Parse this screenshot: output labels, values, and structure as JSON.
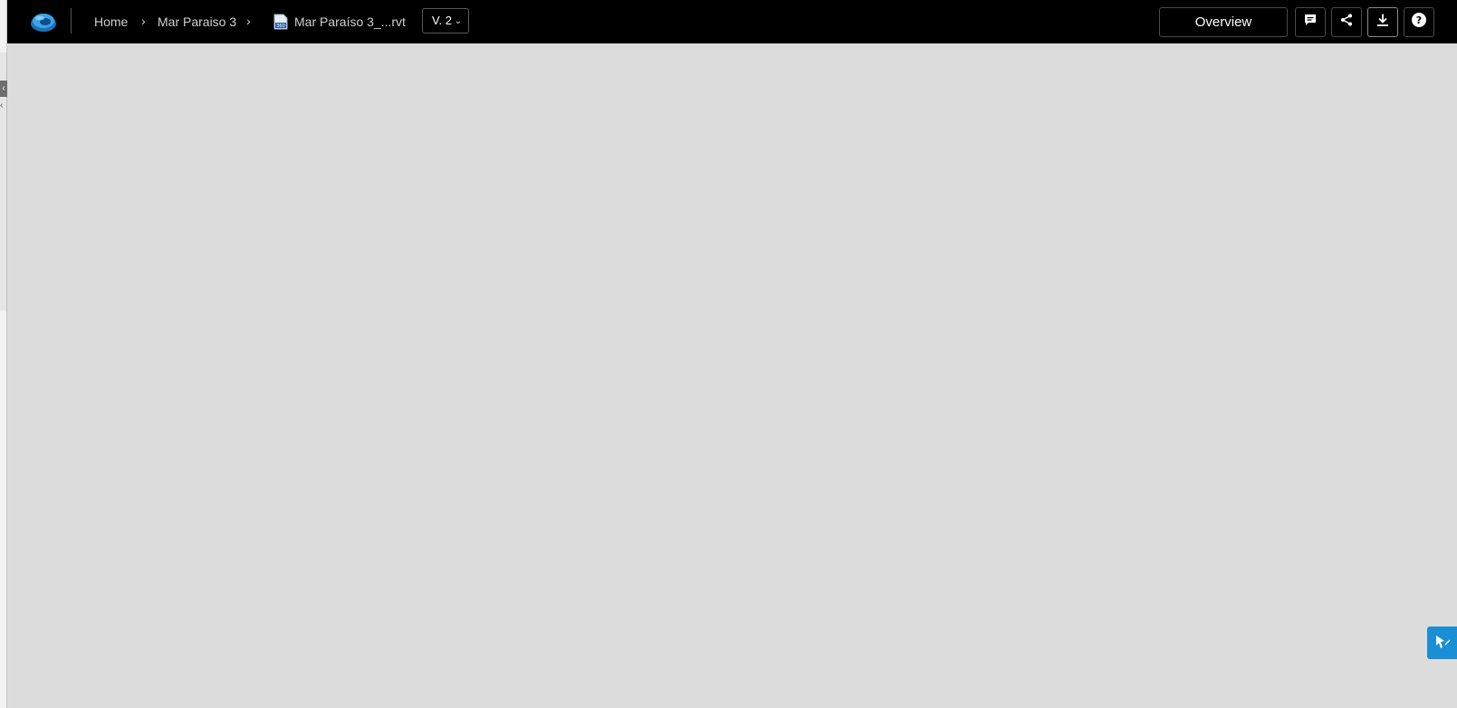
{
  "header": {
    "breadcrumbs": [
      {
        "label": "Home"
      },
      {
        "label": "Mar Paraiso 3"
      },
      {
        "label": "Mar Paraíso 3_...rvt"
      }
    ],
    "version": "V. 2",
    "overview_label": "Overview"
  },
  "icons": {
    "logo": "autodesk-viewer-logo",
    "file": "rvt-360-file-icon",
    "comment": "comment-icon",
    "share": "share-icon",
    "download": "download-icon",
    "help": "help-icon",
    "markup_tool": "markup-pen-icon",
    "collapse": "collapse-left-icon"
  },
  "colors": {
    "topbar": "#000000",
    "canvas": "#dcdcdc",
    "accent": "#1a8fd6"
  }
}
